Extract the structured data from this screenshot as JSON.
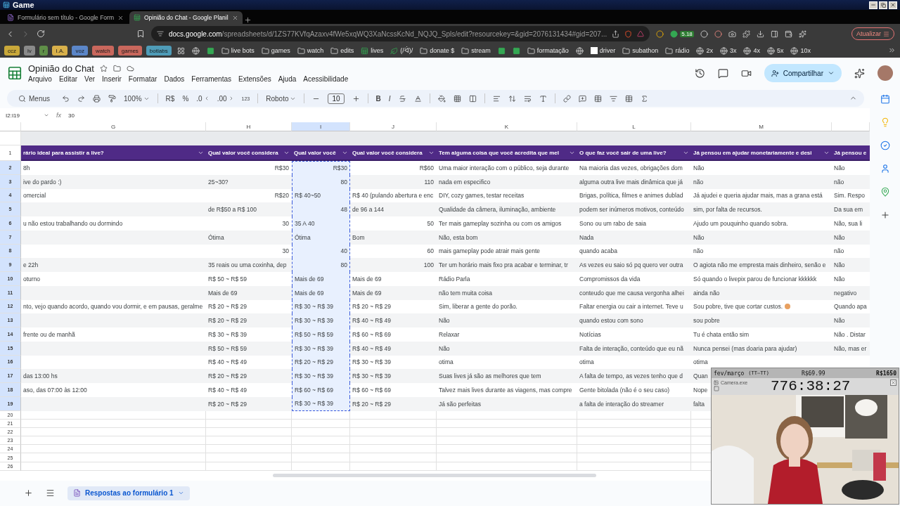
{
  "window": {
    "title": "Game"
  },
  "browser": {
    "tabs": [
      {
        "title": "Formulário sem título - Google Form",
        "selected": false
      },
      {
        "title": "Opinião do Chat - Google Planil",
        "selected": true
      }
    ],
    "url_host": "docs.google.com",
    "url_path": "/spreadsheets/d/1ZS77KVfqAzaxv4fWe5xqWQ3XaNcssKcNd_NQJQ_Spls/edit?resourcekey=&gid=2076131434#gid=207...",
    "extension_badge": "5.18",
    "update_button": "Atualizar",
    "bookmarks": [
      {
        "kind": "chip",
        "label": "ccz",
        "color": "#c9a83a"
      },
      {
        "kind": "chip",
        "label": "lv",
        "color": "#8a8a8a"
      },
      {
        "kind": "chip",
        "label": "r",
        "color": "#5f8f48"
      },
      {
        "kind": "chip",
        "label": "I.A.",
        "color": "#d8b04a"
      },
      {
        "kind": "chip",
        "label": "voz",
        "color": "#5b86c8"
      },
      {
        "kind": "chip",
        "label": "watch",
        "color": "#c9675c"
      },
      {
        "kind": "chip",
        "label": "games",
        "color": "#c9675c"
      },
      {
        "kind": "chip",
        "label": "botlabs",
        "color": "#4f9cb8"
      },
      {
        "kind": "grid"
      },
      {
        "kind": "globe"
      },
      {
        "kind": "app"
      },
      {
        "kind": "folder",
        "label": "live bots"
      },
      {
        "kind": "folder",
        "label": "games"
      },
      {
        "kind": "folder",
        "label": "watch"
      },
      {
        "kind": "folder",
        "label": "edits"
      },
      {
        "kind": "sheet",
        "label": "lives"
      },
      {
        "kind": "leaf",
        "label": "(/ᐛ)/"
      },
      {
        "kind": "folder",
        "label": "donate $"
      },
      {
        "kind": "folder",
        "label": "stream"
      },
      {
        "kind": "app"
      },
      {
        "kind": "app"
      },
      {
        "kind": "folder",
        "label": "formatação"
      },
      {
        "kind": "globe"
      },
      {
        "kind": "blank",
        "label": "driver"
      },
      {
        "kind": "folder",
        "label": "subathon"
      },
      {
        "kind": "folder",
        "label": "rádio"
      },
      {
        "kind": "globe",
        "label": "2x"
      },
      {
        "kind": "globe",
        "label": "3x"
      },
      {
        "kind": "globe",
        "label": "4x"
      },
      {
        "kind": "globe",
        "label": "5x"
      },
      {
        "kind": "globe",
        "label": "10x"
      }
    ]
  },
  "sheet": {
    "title": "Opinião do Chat",
    "menus": [
      "Arquivo",
      "Editar",
      "Ver",
      "Inserir",
      "Formatar",
      "Dados",
      "Ferramentas",
      "Extensões",
      "Ajuda",
      "Acessibilidade"
    ],
    "share_button": "Compartilhar",
    "toolbar": {
      "search": "Menus",
      "zoom": "100%",
      "currency": "R$",
      "percent": "%",
      "decrease_decimals": ".0",
      "increase_decimals": ".00",
      "number_format": "123",
      "font": "Roboto",
      "font_size": "10",
      "bold": "B",
      "italic": "I"
    },
    "name_box": "I2:I19",
    "formula_icon": "fx",
    "formula": "30",
    "columns": [
      {
        "letter": "G",
        "selected": false
      },
      {
        "letter": "H",
        "selected": false
      },
      {
        "letter": "I",
        "selected": true
      },
      {
        "letter": "J",
        "selected": false
      },
      {
        "letter": "K",
        "selected": false
      },
      {
        "letter": "L",
        "selected": false
      },
      {
        "letter": "M",
        "selected": false
      }
    ],
    "header_row": {
      "number": "1",
      "selected": false,
      "cells": [
        "rário ideal para assistir a live?",
        "Qual valor você considera",
        "Qual valor você",
        "Qual valor você considera",
        "Tem alguma coisa que você acredita que mel",
        "O que faz você sair de uma live?",
        "Já pensou em ajudar monetariamente e desi",
        "Já pensou e"
      ]
    },
    "rows": [
      {
        "number": "2",
        "selected": true,
        "cells": [
          "8h",
          "R$30",
          "R$30",
          "R$60",
          "Uma maior interação com o público, seja durante",
          "Na maioria das vezes, obrigações dom",
          "Não",
          "Não"
        ]
      },
      {
        "number": "3",
        "selected": true,
        "cells": [
          "ive do pardo :)",
          "25~30?",
          "80",
          "110",
          "nada em especifico",
          "alguma outra live mais dinâmica que já",
          "não",
          "não"
        ]
      },
      {
        "number": "4",
        "selected": true,
        "cells": [
          "omercial",
          "R$20",
          "R$ 40~50",
          "R$ 40 (pulando abertura e enc",
          "DIY, cozy games, testar receitas",
          "Brigas, política, filmes e animes dublad",
          "Já ajudei e queria ajudar mais, mas a grana está",
          "Sim. Respo"
        ]
      },
      {
        "number": "5",
        "selected": true,
        "cells": [
          "",
          "de R$50 a R$ 100",
          "48",
          "de 96 a 144",
          "Qualidade da câmera, iluminação, ambiente",
          "podem ser inúmeros motivos, conteúdo",
          "sim, por falta de recursos.",
          "Da sua em"
        ]
      },
      {
        "number": "6",
        "selected": true,
        "cells": [
          "u não estou trabalhando ou dormindo",
          "30",
          "35 A 40",
          "50",
          "Ter mais gameplay sozinha ou com os amigos",
          "Sono ou um rabo de saia",
          "Ajudo um pouquinho quando sobra.",
          "Não, sua li"
        ]
      },
      {
        "number": "7",
        "selected": true,
        "cells": [
          "",
          "Ótima",
          "Ótima",
          "Bom",
          "Não, esta bom",
          "Nada",
          "Não",
          "Não"
        ]
      },
      {
        "number": "8",
        "selected": true,
        "cells": [
          "",
          "30",
          "40",
          "60",
          "mais gameplay pode atrair mais gente",
          "quando acaba",
          "não",
          "não"
        ]
      },
      {
        "number": "9",
        "selected": true,
        "cells": [
          "e 22h",
          "35 reais ou uma coxinha, dep",
          "80",
          "100",
          "Ter um horário mais fixo pra acabar e terminar, tr",
          "As vezes eu saio só pq quero ver outra",
          "O agiota não me empresta mais dinheiro, senão e",
          "Não"
        ]
      },
      {
        "number": "10",
        "selected": true,
        "cells": [
          "oturno",
          "R$ 50 ~ R$ 59",
          "Mais de 69",
          "Mais de 69",
          "Rádio Parla",
          "Compromissos da vida",
          "Só quando o livepix parou de funcionar kkkkkk",
          "Não"
        ]
      },
      {
        "number": "11",
        "selected": true,
        "cells": [
          "",
          "Mais de 69",
          "Mais de 69",
          "Mais de 69",
          "não tem muita coisa",
          "conteudo que me causa vergonha alhei",
          "ainda não",
          "negativo"
        ]
      },
      {
        "number": "12",
        "selected": true,
        "cells": [
          "nto, vejo quando acordo, quando vou dormir, e em pausas, geralme",
          "R$ 20 ~ R$ 29",
          "R$ 30 ~ R$ 39",
          "R$ 20 ~ R$ 29",
          "Sim, liberar a gente do porão.",
          "Faltar energia ou cair a internet. Teve u",
          {
            "text": "Sou pobre, tive que cortar custos.",
            "emoji": true
          },
          "Quando apa"
        ]
      },
      {
        "number": "13",
        "selected": true,
        "cells": [
          "",
          "R$ 20 ~ R$ 29",
          "R$ 30 ~ R$ 39",
          "R$ 40 ~ R$ 49",
          "Não",
          "quando estou com sono",
          "sou pobre",
          "Não"
        ]
      },
      {
        "number": "14",
        "selected": true,
        "cells": [
          "frente ou de manhã",
          "R$ 30 ~ R$ 39",
          "R$ 50 ~ R$ 59",
          "R$ 60 ~ R$ 69",
          "Relaxar",
          "Notícias",
          "Tu é chata então sim",
          "Não . Distar"
        ]
      },
      {
        "number": "15",
        "selected": true,
        "cells": [
          "",
          "R$ 50 ~ R$ 59",
          "R$ 30 ~ R$ 39",
          "R$ 40 ~ R$ 49",
          "Não",
          "Falta de interação, conteúdo que eu nã",
          "Nunca pensei (mas doaria para ajudar)",
          "Não, mas er"
        ]
      },
      {
        "number": "16",
        "selected": true,
        "cells": [
          "",
          "R$ 40 ~ R$ 49",
          "R$ 20 ~ R$ 29",
          "R$ 30 ~ R$ 39",
          "otima",
          "otima",
          "otima",
          ""
        ]
      },
      {
        "number": "17",
        "selected": true,
        "cells": [
          "das 13:00 hs",
          "R$ 20 ~ R$ 29",
          "R$ 30 ~ R$ 39",
          "R$ 30 ~ R$ 39",
          "Suas lives já são as melhores que tem",
          "A falta de tempo, as vezes tenho que d",
          "Quan",
          ""
        ]
      },
      {
        "number": "18",
        "selected": true,
        "cells": [
          "aso, das 07:00 às 12:00",
          "R$ 40 ~ R$ 49",
          "R$ 60 ~ R$ 69",
          "R$ 60 ~ R$ 69",
          "Talvez mais lives durante as viagens, mas compre",
          "Gente bitolada (não é o seu caso)",
          "Nope",
          ""
        ]
      },
      {
        "number": "19",
        "selected": true,
        "cells": [
          "",
          "R$ 20 ~ R$ 29",
          "R$ 30 ~ R$ 39",
          "R$ 20 ~ R$ 29",
          "Já são perfeitas",
          "a falta de interação do streamer",
          "falta",
          ""
        ]
      }
    ],
    "empty_rows": [
      {
        "number": "20",
        "selected": false
      },
      {
        "number": "21",
        "selected": false
      },
      {
        "number": "22",
        "selected": false
      },
      {
        "number": "23",
        "selected": false
      },
      {
        "number": "24",
        "selected": false
      },
      {
        "number": "25",
        "selected": false
      },
      {
        "number": "26",
        "selected": false
      }
    ],
    "sheet_tabs": [
      {
        "label": "Respostas ao formulário 1",
        "selected": true
      }
    ]
  },
  "overlay": {
    "period": "fev/março",
    "emoticon": "(TT—TT)",
    "goal_current": "R$69.99",
    "goal_total": "R$1650",
    "app_title": "Camera.exe",
    "timer": "776:38:27"
  }
}
